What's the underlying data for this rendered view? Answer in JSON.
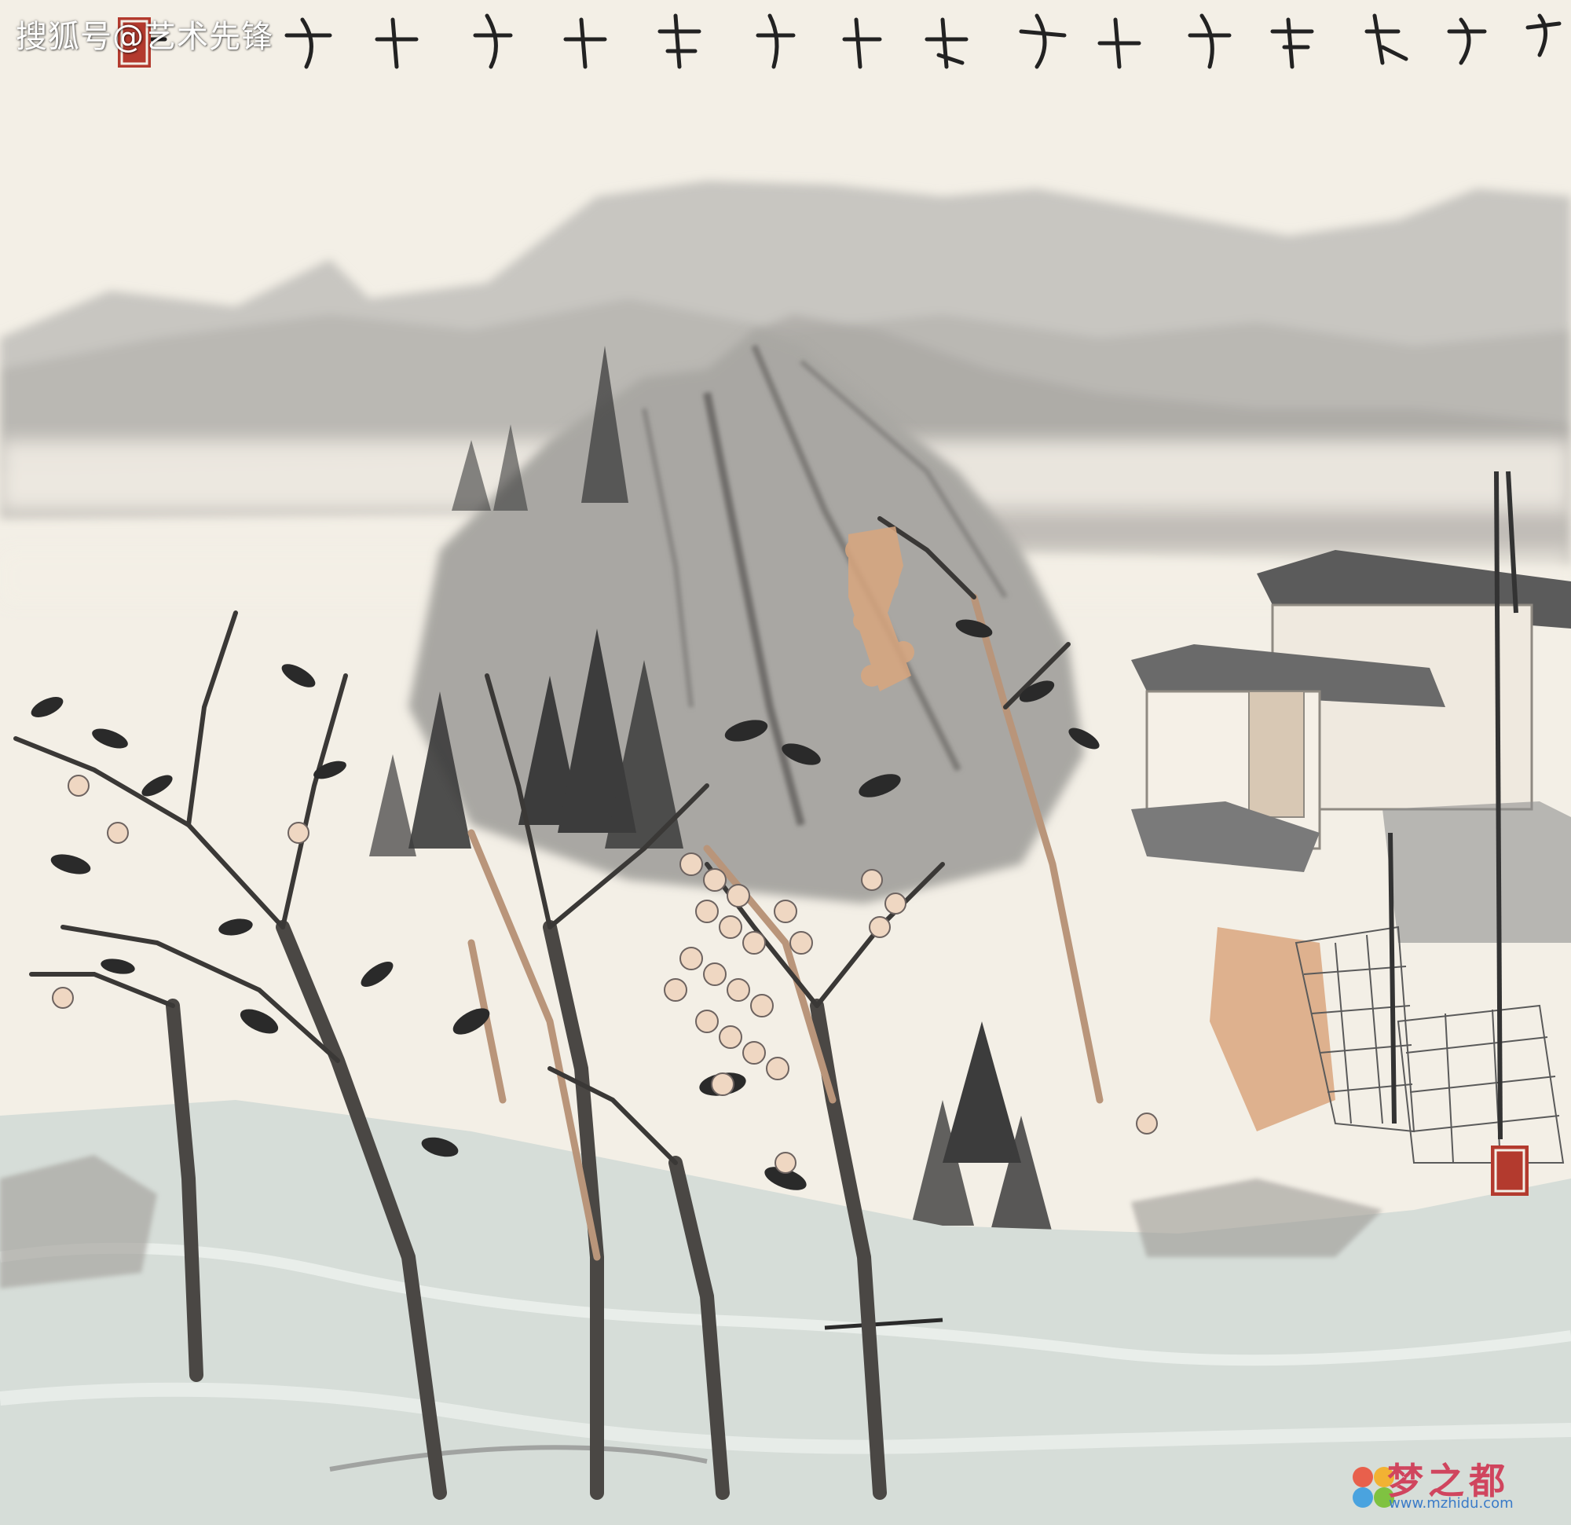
{
  "watermark": {
    "top_left": "搜狐号@艺术先锋",
    "site_name": "梦之都",
    "site_url": "www.mzhidu.com"
  },
  "colors": {
    "paper": "#f3efe6",
    "ink_dark": "#2a2a2a",
    "ink_mid": "#8a8a8a",
    "ink_light": "#c9c7c2",
    "ochre": "#d9a67e",
    "seal_red": "#b33a2e",
    "water": "#cfd8d3"
  }
}
